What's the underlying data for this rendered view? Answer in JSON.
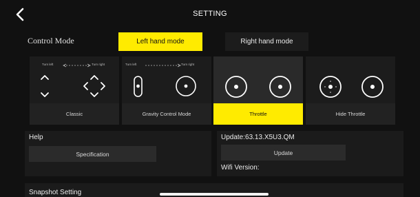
{
  "header": {
    "title": "SETTING",
    "back_icon": "chevron-left-icon"
  },
  "control_mode": {
    "label": "Control Mode",
    "left_hand_label": "Left hand mode",
    "right_hand_label": "Right hand mode",
    "selected": "Left hand mode"
  },
  "modes": [
    {
      "label": "Classic",
      "hint_left": "Turn left",
      "hint_right": "Turn right"
    },
    {
      "label": "Gravity Control Mode",
      "hint_left": "Turn left",
      "hint_right": "Turn right"
    },
    {
      "label": "Throttle"
    },
    {
      "label": "Hide Throttle"
    }
  ],
  "selected_mode": "Throttle",
  "help": {
    "title": "Help",
    "specification_label": "Specification"
  },
  "update": {
    "version_text": "Update:63.13.X5U3.QM",
    "button_label": "Update",
    "wifi_label": "Wifi Version:"
  },
  "snapshot": {
    "title": "Snapshot Setting"
  },
  "colors": {
    "accent": "#ffeb00",
    "background": "#111111",
    "panel": "#1b1b1b"
  }
}
